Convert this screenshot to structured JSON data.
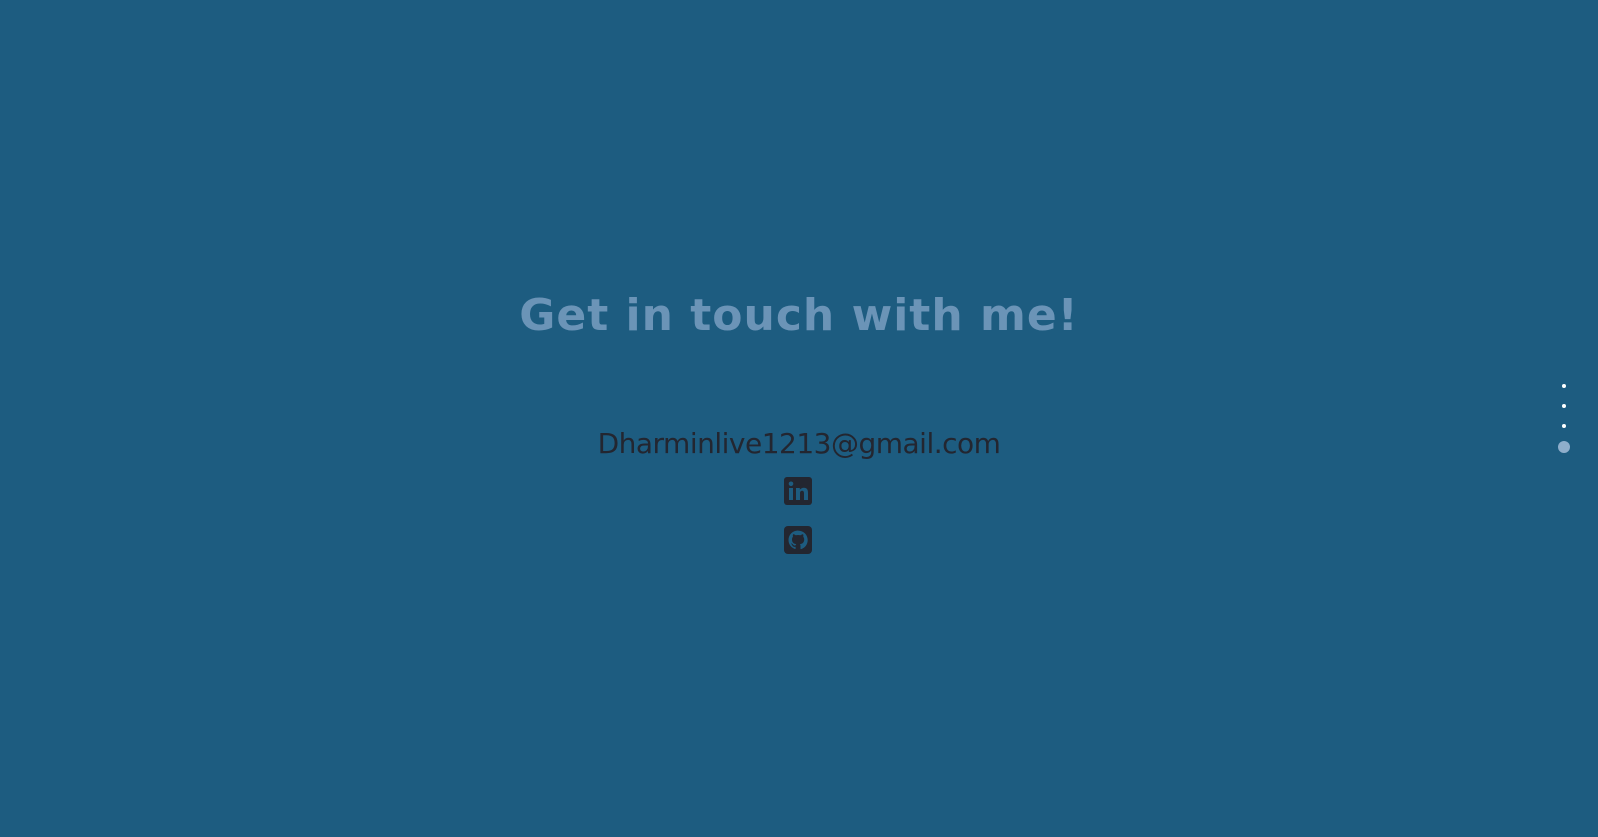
{
  "contact": {
    "heading": "Get in touch with me!",
    "email": "Dharminlive1213@gmail.com",
    "social": [
      {
        "icon": "linkedin-icon"
      },
      {
        "icon": "github-icon"
      }
    ]
  },
  "section_nav": {
    "dot_count": 4,
    "active_index": 3
  },
  "colors": {
    "background": "#1d5c80",
    "heading": "#6b94b7",
    "text": "#232630",
    "dot": "#ffffff",
    "dot_active": "#8faecb"
  }
}
